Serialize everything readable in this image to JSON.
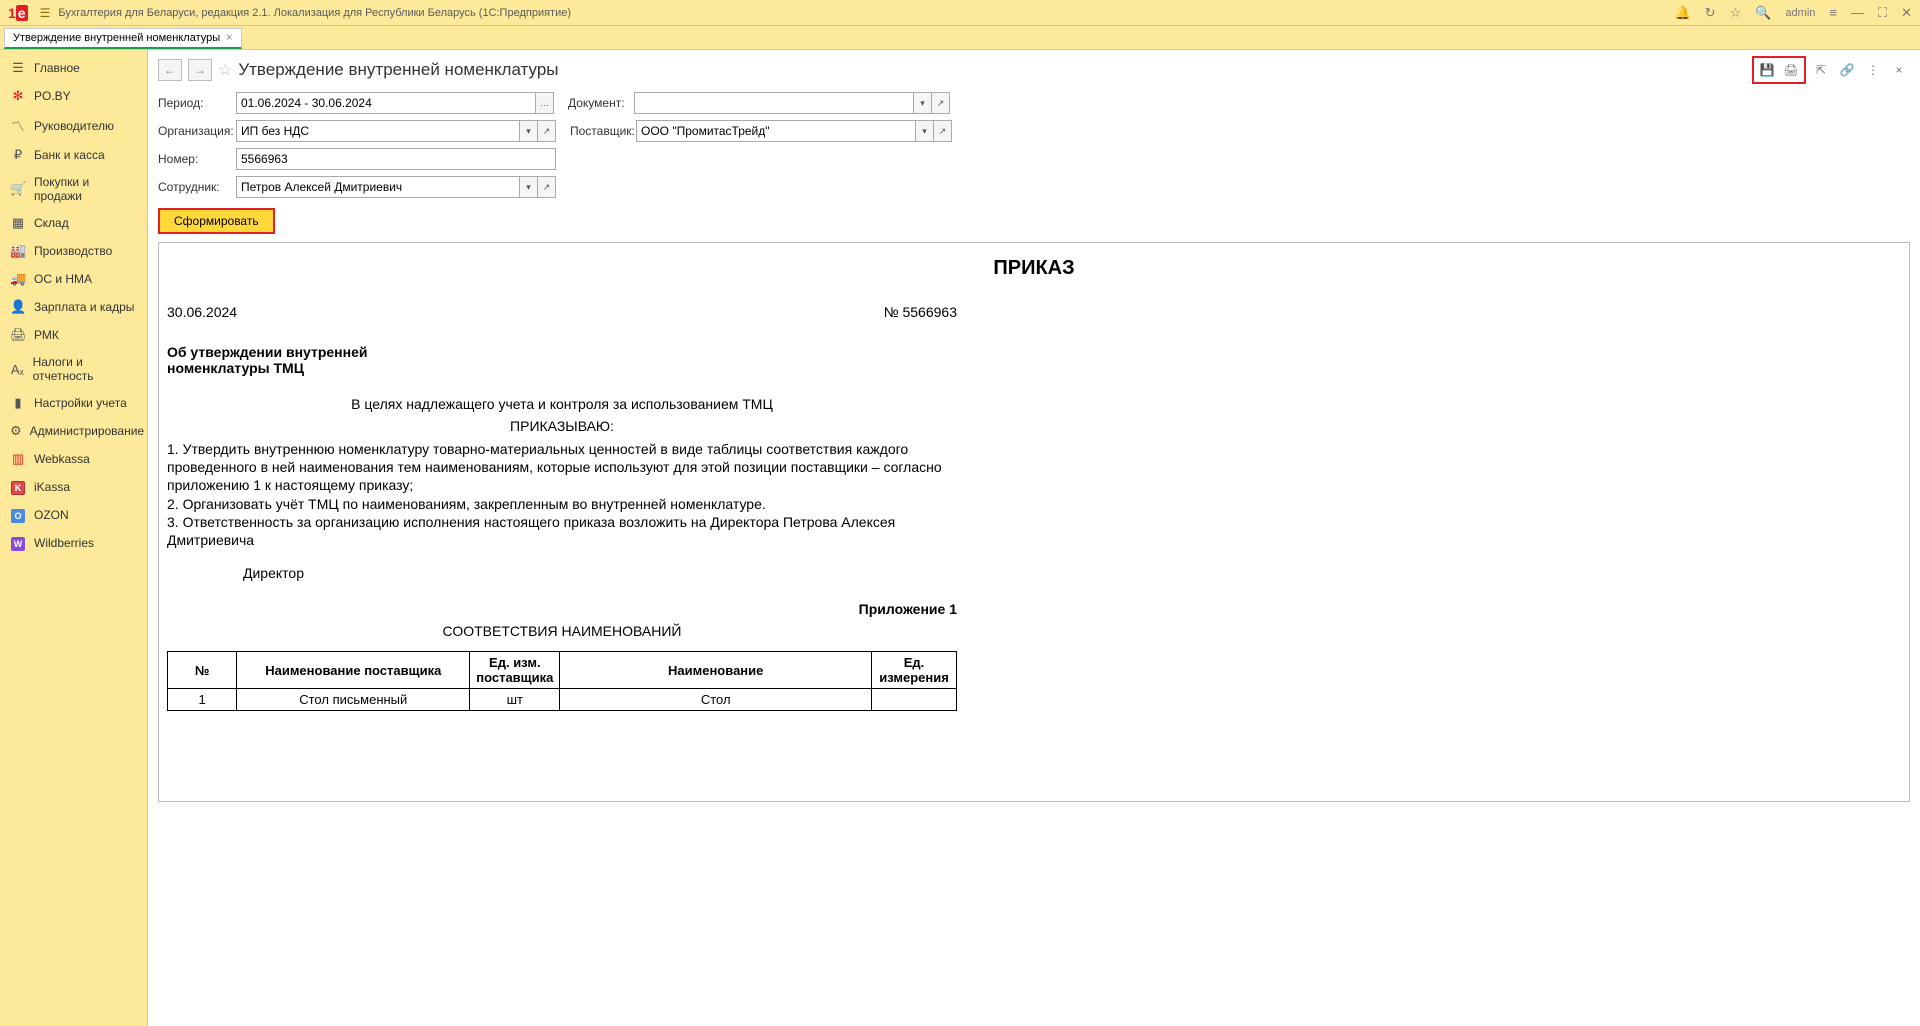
{
  "titlebar": {
    "app_title": "Бухгалтерия для Беларуси, редакция 2.1. Локализация для Республики Беларусь  (1С:Предприятие)",
    "user": "admin"
  },
  "tab": {
    "label": "Утверждение внутренней номенклатуры"
  },
  "sidebar": [
    {
      "label": "Главное"
    },
    {
      "label": "PO.BY"
    },
    {
      "label": "Руководителю"
    },
    {
      "label": "Банк и касса"
    },
    {
      "label": "Покупки и продажи"
    },
    {
      "label": "Склад"
    },
    {
      "label": "Производство"
    },
    {
      "label": "ОС и НМА"
    },
    {
      "label": "Зарплата и кадры"
    },
    {
      "label": "РМК"
    },
    {
      "label": "Налоги и отчетность"
    },
    {
      "label": "Настройки учета"
    },
    {
      "label": "Администрирование"
    },
    {
      "label": "Webkassa"
    },
    {
      "label": "iKassa"
    },
    {
      "label": "OZON"
    },
    {
      "label": "Wildberries"
    }
  ],
  "header": {
    "title": "Утверждение внутренней номенклатуры"
  },
  "form": {
    "period_label": "Период:",
    "period_value": "01.06.2024 - 30.06.2024",
    "document_label": "Документ:",
    "document_value": "",
    "org_label": "Организация:",
    "org_value": "ИП без НДС",
    "supplier_label": "Поставщик:",
    "supplier_value": "ООО \"ПромитасТрейд\"",
    "number_label": "Номер:",
    "number_value": "5566963",
    "employee_label": "Сотрудник:",
    "employee_value": "Петров Алексей Дмитриевич",
    "generate_button": "Сформировать"
  },
  "report": {
    "title": "ПРИКАЗ",
    "date": "30.06.2024",
    "number": "№ 5566963",
    "subject": "Об утверждении внутренней номенклатуры ТМЦ",
    "intro": "В целях надлежащего учета и контроля за использованием ТМЦ",
    "order_word": "ПРИКАЗЫВАЮ:",
    "body1": "1.  Утвердить внутреннюю номенклатуру товарно-материальных ценностей в виде таблицы соответствия каждого проведенного в ней наименования тем наименованиям, которые используют для этой позиции поставщики – согласно приложению 1 к настоящему приказу;",
    "body2": "2.  Организовать учёт ТМЦ по наименованиям, закрепленным во внутренней номенклатуре.",
    "body3": "3.  Ответственность за организацию исполнения настоящего приказа возложить на Директора Петрова Алексея Дмитриевича",
    "director": "Директор",
    "attachment": "Приложение 1",
    "attachment_title": "СООТВЕТСТВИЯ НАИМЕНОВАНИЙ",
    "columns": {
      "num": "№",
      "supplier_name": "Наименование поставщика",
      "supplier_unit": "Ед. изм. поставщика",
      "name": "Наименование",
      "unit": "Ед. измерения"
    },
    "rows": [
      {
        "num": "1",
        "supplier_name": "Стол письменный",
        "supplier_unit": "шт",
        "name": "Стол",
        "unit": ""
      }
    ]
  }
}
